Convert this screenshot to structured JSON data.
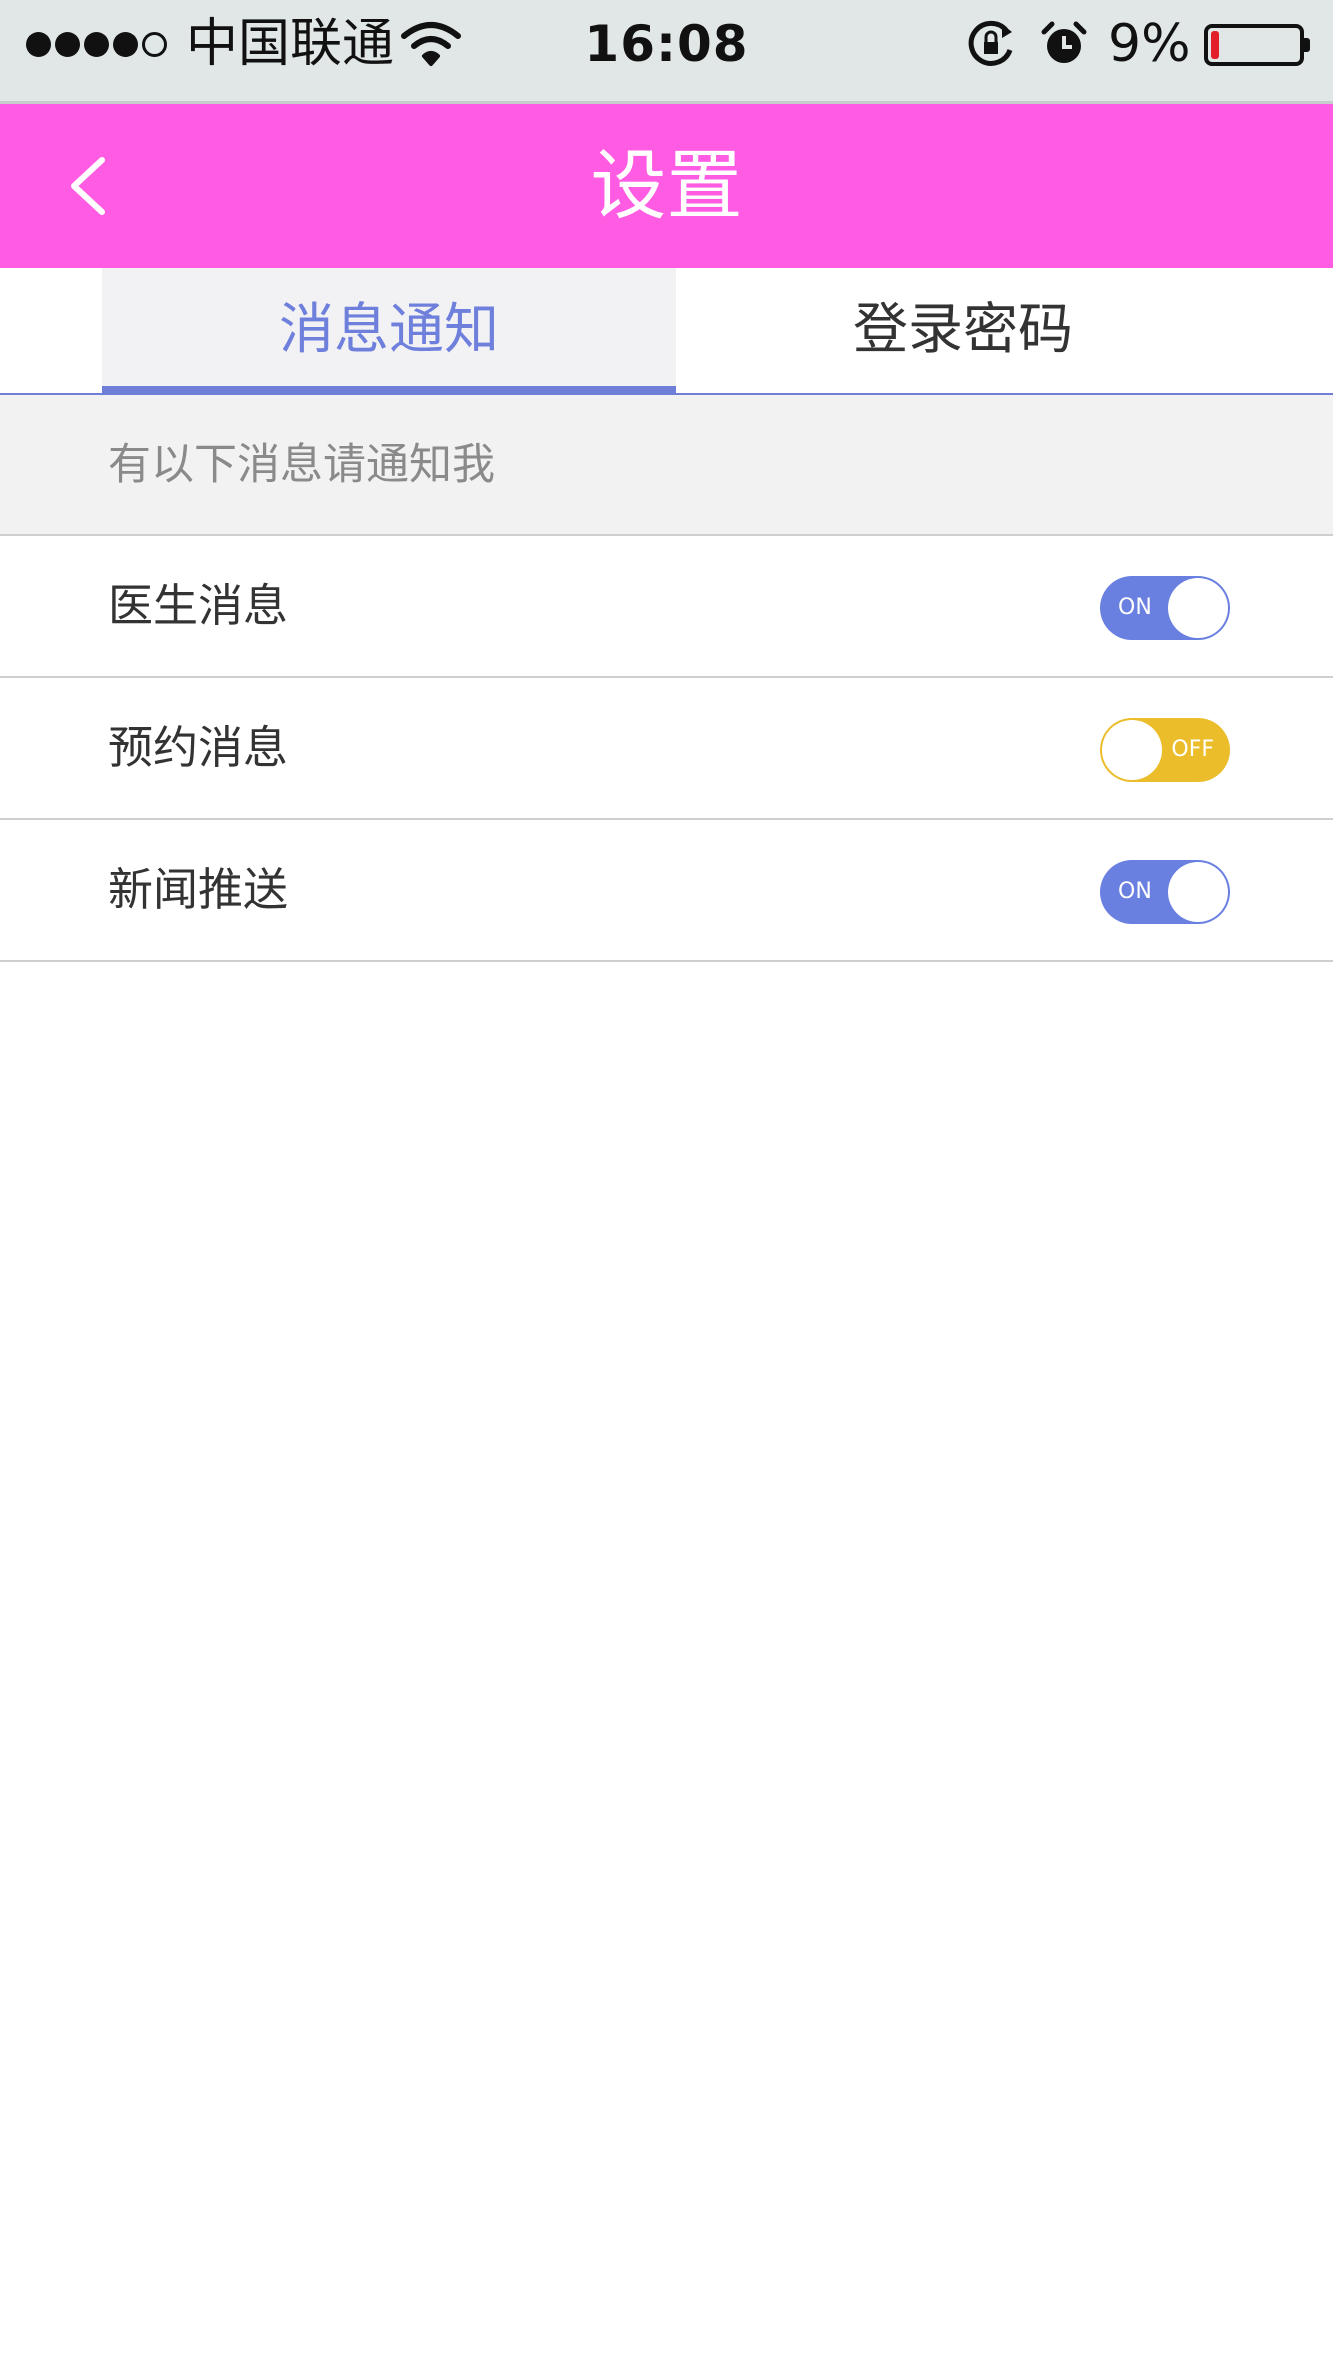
{
  "status_bar": {
    "carrier": "中国联通",
    "time": "16:08",
    "battery_percent": "9%",
    "battery_level": 0.09,
    "battery_color": "#e3202a",
    "signal_strength": "4 of 5",
    "icons": [
      "signal-dots-icon",
      "wifi-icon",
      "rotation-lock-icon",
      "alarm-icon",
      "battery-icon"
    ]
  },
  "nav": {
    "title": "设置",
    "back_icon": "chevron-left-icon",
    "background_color": "#ff5ce3"
  },
  "tabs": [
    {
      "label": "消息通知",
      "active": true
    },
    {
      "label": "登录密码",
      "active": false
    }
  ],
  "accent_color": "#6f7fd7",
  "section": {
    "header": "有以下消息请通知我"
  },
  "settings": [
    {
      "label": "医生消息",
      "state": "ON",
      "enabled": true,
      "color": "#6a80e0"
    },
    {
      "label": "预约消息",
      "state": "OFF",
      "enabled": false,
      "color": "#ecbd2b"
    },
    {
      "label": "新闻推送",
      "state": "ON",
      "enabled": true,
      "color": "#6a80e0"
    }
  ]
}
